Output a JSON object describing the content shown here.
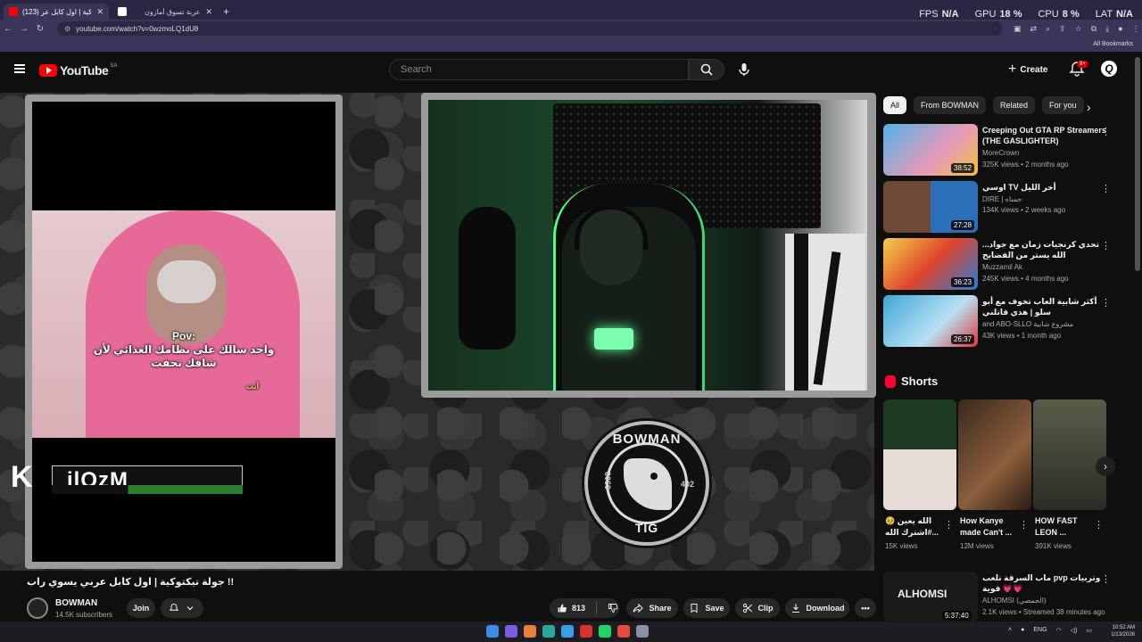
{
  "browser": {
    "tabs": [
      {
        "title": "(123) جولة تيكتوكية | اول كابل عر",
        "active": true,
        "favicon_color": "#ff0000"
      },
      {
        "title": "عربة تسوق أمازون",
        "active": false,
        "favicon_color": "#ffffff"
      }
    ],
    "new_tab": "+",
    "perf": {
      "fps_label": "FPS",
      "fps": "N/A",
      "gpu_label": "GPU",
      "gpu": "18 %",
      "cpu_label": "CPU",
      "cpu": "8 %",
      "lat_label": "LAT",
      "lat": "N/A"
    },
    "url": "youtube.com/watch?v=0wzmoLQ1dU8",
    "all_bookmarks": "All Bookmarks"
  },
  "youtube": {
    "logo": "YouTube",
    "country": "SA",
    "search_placeholder": "Search",
    "create_label": "Create",
    "notifications_badge": "9+",
    "avatar_letter": "Q"
  },
  "video_overlay": {
    "pov_line1": "Pov:",
    "pov_line2": "واحد سالك على نظامك الغذائي لأن",
    "pov_line3": "شافك نحفت",
    "pov_you": "أنت",
    "streamer_tag": "ilQzM",
    "k_logo": "K",
    "emblem_top": "BOWMAN",
    "emblem_bottom": "TIG",
    "emblem_left": "0069",
    "emblem_right": "402"
  },
  "video": {
    "title": "جولة تيكتوكية | اول كابل عربي يسوي راب !!",
    "channel": "BOWMAN",
    "subscribers": "14.5K subscribers",
    "join": "Join",
    "likes": "813",
    "share": "Share",
    "save": "Save",
    "clip": "Clip",
    "download": "Download"
  },
  "sidebar": {
    "chips": [
      "All",
      "From BOWMAN",
      "Related",
      "For you"
    ],
    "recommendations": [
      {
        "title": "Creeping Out GTA RP Streamers (THE GASLIGHTER)",
        "channel": "MoreCrown",
        "meta": "325K views • 2 months ago",
        "duration": "38:52",
        "thumb_color": "#4fb3e8"
      },
      {
        "title": "اوسي TV أخر الليل",
        "channel": "DIRE | حساه",
        "meta": "134K views • 2 weeks ago",
        "duration": "27:28",
        "thumb_color": "#2b6fb8"
      },
      {
        "title": "تحدي كرنجيات زمان مع جواد... الله يستر من الفضايح",
        "channel": "Muzzamil Ak",
        "meta": "245K views • 4 months ago",
        "duration": "36:23",
        "thumb_color": "#e0452b"
      },
      {
        "title": "أكثر شابية العاب تخوف مع أبو سلو | هذي قاتلني",
        "channel": "and ABO-SLLO مشروع شابية",
        "meta": "43K views • 1 month ago",
        "duration": "26:37",
        "thumb_color": "#3fa7d6"
      }
    ],
    "shorts_label": "Shorts",
    "shorts": [
      {
        "title": "الله يعين 🥹 ...#اشترك الله",
        "views": "15K views",
        "thumb_color": "#3c2a2a"
      },
      {
        "title": "How Kanye made Can't ...",
        "views": "12M views",
        "thumb_color": "#6b4a32"
      },
      {
        "title": "HOW FAST LEON ...",
        "views": "391K views",
        "thumb_color": "#4a4c3e"
      }
    ],
    "live": {
      "title": "ماب السرقة نلعب pvp وتربيات قوية 💗💗",
      "channel": "ALHOMSI (الحمصي)",
      "meta": "2.1K views • Streamed 38 minutes ago",
      "duration": "5:37:40",
      "thumb_text": "ALHOMSI"
    }
  },
  "taskbar": {
    "lang": "ENG",
    "time": "10:52 AM",
    "date": "1/13/2026",
    "icon_colors": [
      "#3c8ce7",
      "#7c5ce0",
      "#e8823a",
      "#2aa5a0",
      "#39a0e8",
      "#d9322b",
      "#1ed760",
      "#e34b3c",
      "#8a8fa8"
    ]
  }
}
